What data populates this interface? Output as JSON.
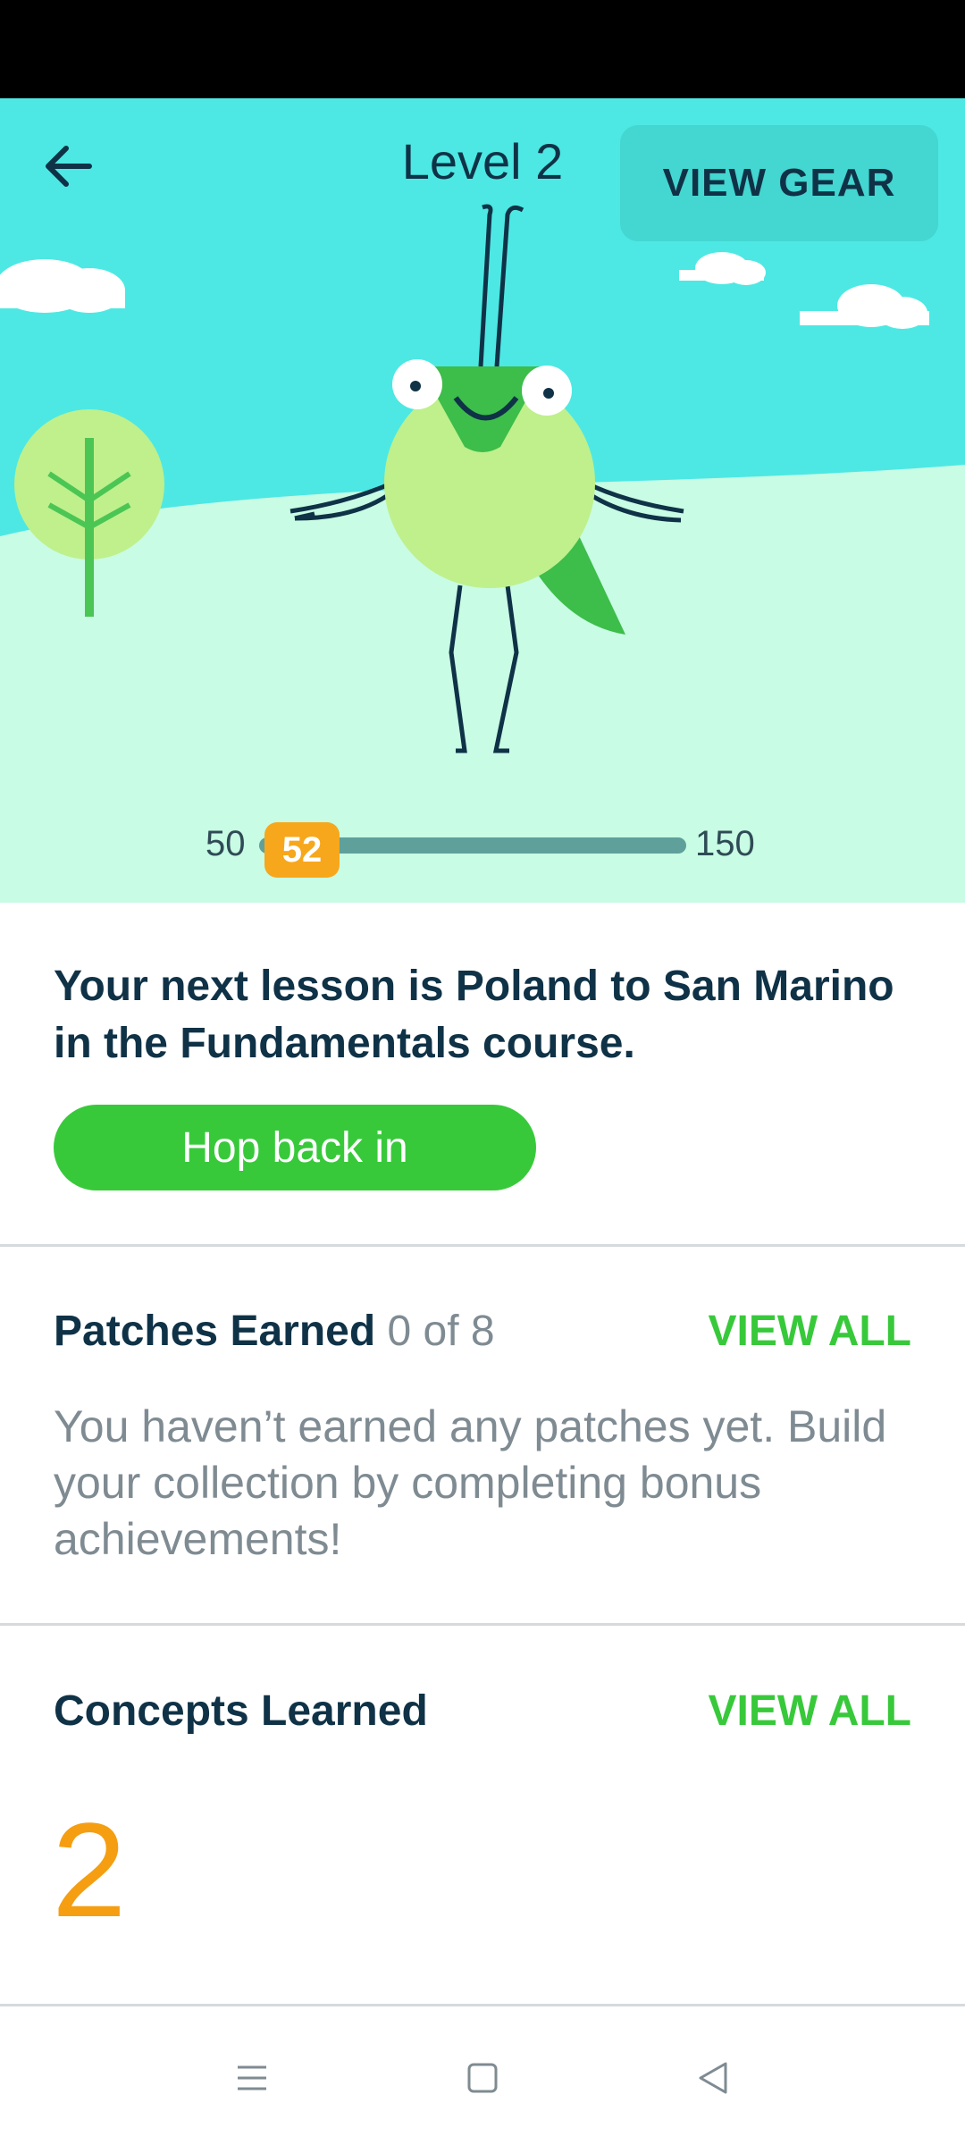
{
  "header": {
    "level_title": "Level 2",
    "view_gear_label": "VIEW GEAR"
  },
  "progress": {
    "min_label": "50",
    "max_label": "150",
    "current_label": "52",
    "current_value": 52,
    "min": 50,
    "max": 150
  },
  "lesson": {
    "text": "Your next lesson is Poland to San Marino in the Fundamentals course.",
    "button_label": "Hop back in"
  },
  "patches": {
    "title": "Patches Earned",
    "count": "0 of 8",
    "view_all_label": "VIEW ALL",
    "description": "You haven’t earned any patches yet. Build your collection by completing bonus achievements!"
  },
  "concepts": {
    "title": "Concepts Learned",
    "view_all_label": "VIEW ALL",
    "count": "2"
  },
  "colors": {
    "sky": "#4de8e3",
    "hill": "#c8fce4",
    "accent_green": "#38c93b",
    "accent_orange": "#f59e12",
    "text_dark": "#0f3247"
  },
  "icons": {
    "back": "arrow-left-icon",
    "menu": "menu-icon",
    "home": "square-icon",
    "nav_back": "triangle-back-icon"
  }
}
